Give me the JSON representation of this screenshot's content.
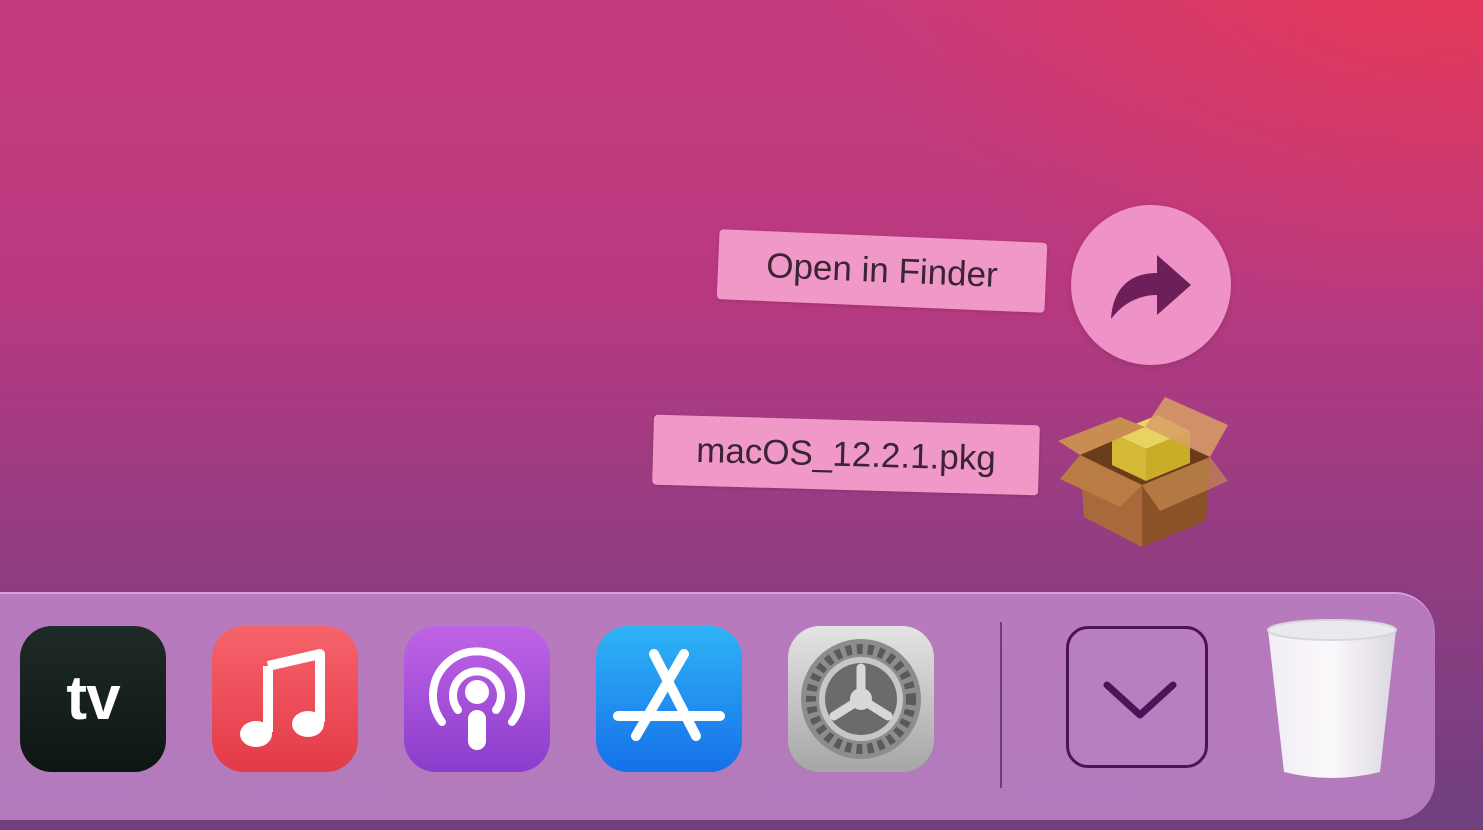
{
  "stack": {
    "open_in_finder_label": "Open in Finder",
    "file_label": "macOS_12.2.1.pkg",
    "finder_icon": "curved-arrow-right-icon",
    "file_icon": "package-box-icon"
  },
  "dock": {
    "apps": [
      {
        "name": "apple-tv",
        "icon": "apple-tv-icon",
        "glyph": "tv"
      },
      {
        "name": "music",
        "icon": "music-note-icon"
      },
      {
        "name": "podcasts",
        "icon": "podcasts-icon"
      },
      {
        "name": "app-store",
        "icon": "app-store-icon"
      },
      {
        "name": "system-preferences",
        "icon": "gear-icon"
      }
    ],
    "downloads_icon": "chevron-down-icon",
    "trash_icon": "trash-icon"
  },
  "colors": {
    "label_bg": "#f099c9",
    "arrow": "#6c1f58",
    "dock_bg": "#c48ccd"
  }
}
